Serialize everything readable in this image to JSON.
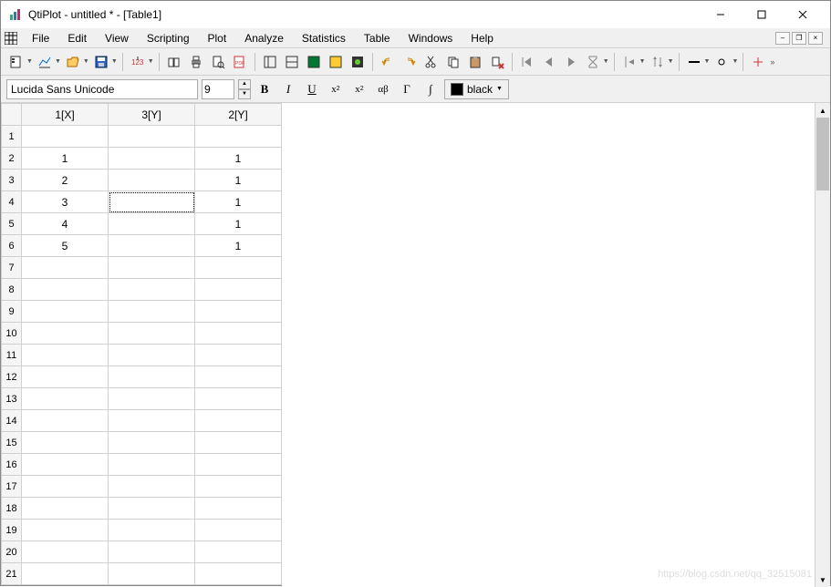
{
  "window": {
    "title": "QtiPlot - untitled * - [Table1]"
  },
  "menu": {
    "items": [
      "File",
      "Edit",
      "View",
      "Scripting",
      "Plot",
      "Analyze",
      "Statistics",
      "Table",
      "Windows",
      "Help"
    ]
  },
  "format": {
    "font": "Lucida Sans Unicode",
    "size": "9",
    "color_label": "black"
  },
  "table": {
    "columns": [
      "1[X]",
      "3[Y]",
      "2[Y]"
    ],
    "row_count": 21,
    "selected": {
      "row": 4,
      "col": 2
    },
    "rows": [
      {
        "n": 1,
        "cells": [
          "",
          "",
          ""
        ]
      },
      {
        "n": 2,
        "cells": [
          "1",
          "",
          "1"
        ]
      },
      {
        "n": 3,
        "cells": [
          "2",
          "",
          "1"
        ]
      },
      {
        "n": 4,
        "cells": [
          "3",
          "",
          "1"
        ]
      },
      {
        "n": 5,
        "cells": [
          "4",
          "",
          "1"
        ]
      },
      {
        "n": 6,
        "cells": [
          "5",
          "",
          "1"
        ]
      },
      {
        "n": 7,
        "cells": [
          "",
          "",
          ""
        ]
      },
      {
        "n": 8,
        "cells": [
          "",
          "",
          ""
        ]
      },
      {
        "n": 9,
        "cells": [
          "",
          "",
          ""
        ]
      },
      {
        "n": 10,
        "cells": [
          "",
          "",
          ""
        ]
      },
      {
        "n": 11,
        "cells": [
          "",
          "",
          ""
        ]
      },
      {
        "n": 12,
        "cells": [
          "",
          "",
          ""
        ]
      },
      {
        "n": 13,
        "cells": [
          "",
          "",
          ""
        ]
      },
      {
        "n": 14,
        "cells": [
          "",
          "",
          ""
        ]
      },
      {
        "n": 15,
        "cells": [
          "",
          "",
          ""
        ]
      },
      {
        "n": 16,
        "cells": [
          "",
          "",
          ""
        ]
      },
      {
        "n": 17,
        "cells": [
          "",
          "",
          ""
        ]
      },
      {
        "n": 18,
        "cells": [
          "",
          "",
          ""
        ]
      },
      {
        "n": 19,
        "cells": [
          "",
          "",
          ""
        ]
      },
      {
        "n": 20,
        "cells": [
          "",
          "",
          ""
        ]
      },
      {
        "n": 21,
        "cells": [
          "",
          "",
          ""
        ]
      }
    ]
  },
  "watermark": "https://blog.csdn.net/qq_32515081"
}
